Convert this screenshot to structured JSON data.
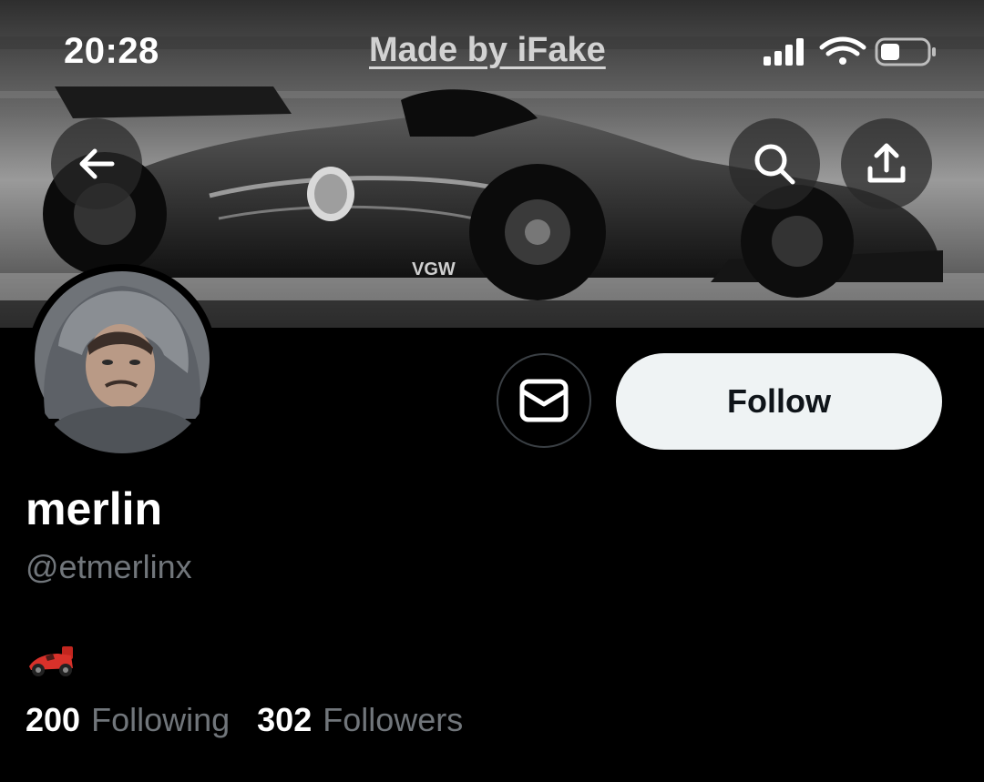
{
  "status_bar": {
    "time": "20:28",
    "watermark": "Made by iFake",
    "icons": [
      "cellular-signal-icon",
      "wifi-icon",
      "battery-icon"
    ]
  },
  "header": {
    "icons": [
      "back-arrow-icon",
      "search-icon",
      "share-icon"
    ]
  },
  "profile": {
    "display_name": "merlin",
    "handle": "@etmerlinx",
    "bio_icon": "race-car-emoji",
    "follow_label": "Follow",
    "message_icon": "mail-icon"
  },
  "stats": {
    "following_count": "200",
    "following_label": "Following",
    "followers_count": "302",
    "followers_label": "Followers"
  },
  "colors": {
    "background": "#000000",
    "follow_button_bg": "#eff3f4",
    "follow_button_text": "#0f1419",
    "muted_text": "#71767b",
    "primary_text": "#ffffff"
  }
}
